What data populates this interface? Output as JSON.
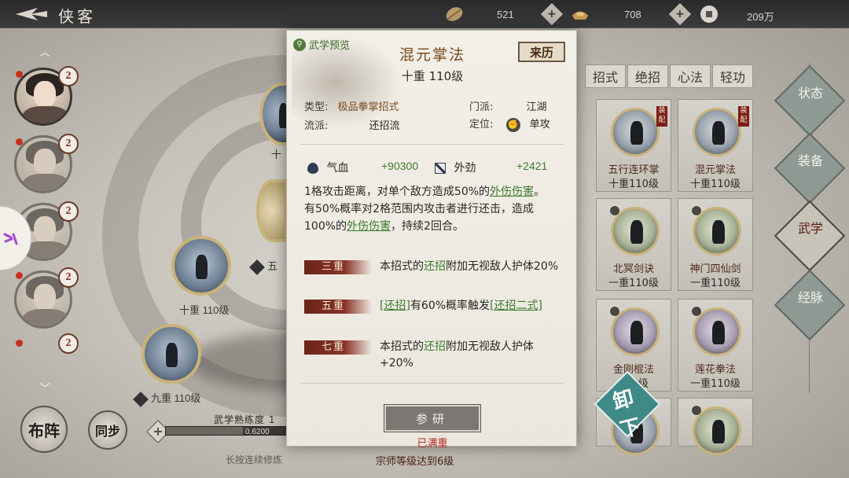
{
  "header": {
    "title": "侠客",
    "resources": [
      {
        "icon": "leaf-token-icon",
        "value": "521"
      },
      {
        "icon": "gold-ingot-icon",
        "value": "708"
      },
      {
        "icon": "coin-icon",
        "value": "209万"
      }
    ]
  },
  "heroes": [
    {
      "level": "2"
    },
    {
      "level": "2"
    },
    {
      "level": "2"
    },
    {
      "level": "2"
    },
    {
      "level": "2"
    }
  ],
  "left_skills": {
    "level_a": "十重 110级",
    "level_b": "九重 110级",
    "partial_a": "十",
    "partial_b": "五"
  },
  "bottom": {
    "formation_label": "布阵",
    "sync_label": "同步",
    "proficiency_label": "武学熟练度 1",
    "proficiency_value": "0.6200",
    "press_hint": "长按连续修炼",
    "requirement": "宗师等级达到6级"
  },
  "category_tabs": [
    "招式",
    "绝招",
    "心法",
    "轻功"
  ],
  "skill_cards": [
    {
      "name": "五行连环掌",
      "level": "十重110级",
      "flag": "装配"
    },
    {
      "name": "混元掌法",
      "level": "十重110级",
      "flag": "装配"
    },
    {
      "name": "北冥剑诀",
      "level": "一重110级",
      "flag": ""
    },
    {
      "name": "神门四仙剑",
      "level": "一重110级",
      "flag": ""
    },
    {
      "name": "金刚棍法",
      "level": "110级",
      "flag": ""
    },
    {
      "name": "莲花拳法",
      "level": "一重110级",
      "flag": ""
    }
  ],
  "side_nav": [
    "状态",
    "装备",
    "武学",
    "经脉"
  ],
  "unequip_label": "卸下",
  "popup": {
    "preview_tag": "武学预览",
    "title": "混元掌法",
    "source_button": "来历",
    "level": "十重 110级",
    "type_label": "类型:",
    "type_value": "极品拳掌招式",
    "sect_label": "门派:",
    "sect_value": "江湖",
    "school_label": "流派:",
    "school_value": "还招流",
    "role_label": "定位:",
    "role_value": "单攻",
    "stats": [
      {
        "name": "气血",
        "value": "+90300"
      },
      {
        "name": "外劲",
        "value": "+2421"
      }
    ],
    "desc_1": "1格攻击距离，对单个敌方造成50%的",
    "desc_link_1": "外伤伤害",
    "desc_2": "。有50%概率对2格范围内攻击者进行还击，造成100%的",
    "desc_link_2": "外伤伤害",
    "desc_3": "，持续2回合。",
    "tiers": [
      {
        "badge": "三重",
        "pre": "本招式的",
        "hl": "还招",
        "post": "附加无视敌人护体20%"
      },
      {
        "badge": "五重",
        "pre": "",
        "hl": "[还招]",
        "post": "有60%概率触发",
        "hl2": "[还招二式]"
      },
      {
        "badge": "七重",
        "pre": "本招式的",
        "hl": "还招",
        "post": "附加无视敌人护体+20%"
      }
    ],
    "research_button": "参研",
    "status": "已满重"
  }
}
